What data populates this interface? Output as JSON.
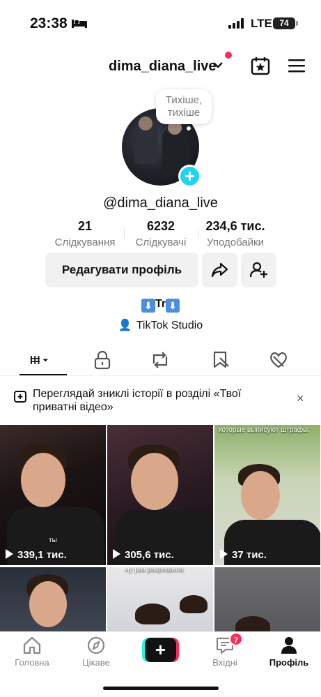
{
  "status_bar": {
    "time": "23:38",
    "network": "LTE",
    "battery": "74"
  },
  "header": {
    "username": "dima_diana_live"
  },
  "profile": {
    "bubble_note": "Тихіше, тихіше",
    "handle": "@dima_diana_live",
    "stats": [
      {
        "value": "21",
        "label": "Слідкування"
      },
      {
        "value": "6232",
        "label": "Слідкувачі"
      },
      {
        "value": "234,6 тис.",
        "label": "Уподобайки"
      }
    ],
    "edit_button": "Редагувати профіль",
    "bio": "Tr",
    "studio_link": "TikTok Studio"
  },
  "banner": {
    "text": "Переглядай зниклі історії в розділі «Твої приватні відео»",
    "close": "×"
  },
  "videos": [
    {
      "views": "339,1 тис.",
      "caption": "ты"
    },
    {
      "views": "305,6 тис.",
      "caption": ""
    },
    {
      "views": "37 тис.",
      "caption": "которые выписуют штрафы:"
    },
    {
      "views": "",
      "caption": ""
    },
    {
      "views": "",
      "caption": "ну раз разрешила"
    },
    {
      "views": "",
      "caption": ""
    }
  ],
  "nav": {
    "home": "Головна",
    "discover": "Цікаве",
    "plus": "+",
    "inbox": "Вхідні",
    "inbox_badge": "7",
    "profile": "Профіль"
  },
  "colors": {
    "accent": "#fe2c55",
    "cyan": "#25f4ee",
    "add_button": "#20d5ec"
  }
}
